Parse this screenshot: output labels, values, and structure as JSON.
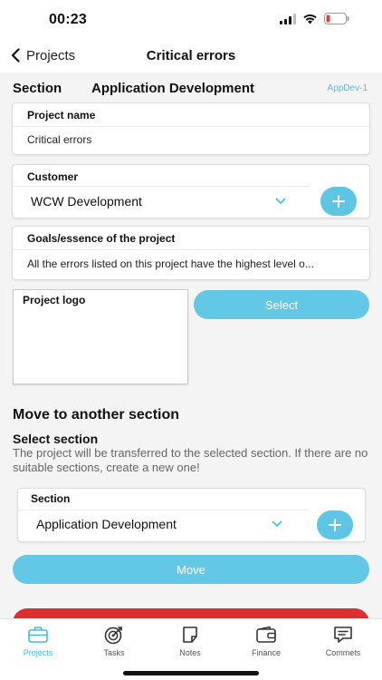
{
  "status_bar": {
    "time": "00:23"
  },
  "nav": {
    "back_label": "Projects",
    "title": "Critical errors"
  },
  "section": {
    "label": "Section",
    "value": "Application Development",
    "code": "AppDev-1"
  },
  "fields": {
    "project_name": {
      "label": "Project name",
      "value": "Critical errors"
    },
    "customer": {
      "label": "Customer",
      "value": "WCW Development"
    },
    "goals": {
      "label": "Goals/essence of the project",
      "value": "All the errors listed on this project have the highest level o..."
    },
    "logo": {
      "label": "Project logo",
      "select_label": "Select"
    }
  },
  "move": {
    "heading": "Move to another section",
    "subheading": "Select section",
    "help": "The project will be transferred to the selected section. If there are no suitable sections, create a new one!",
    "section_label": "Section",
    "section_value": "Application Development",
    "move_label": "Move"
  },
  "tabs": [
    {
      "label": "Projects",
      "icon": "briefcase-icon",
      "active": true
    },
    {
      "label": "Tasks",
      "icon": "target-icon",
      "active": false
    },
    {
      "label": "Notes",
      "icon": "note-icon",
      "active": false
    },
    {
      "label": "Finance",
      "icon": "wallet-icon",
      "active": false
    },
    {
      "label": "Commets",
      "icon": "chat-icon",
      "active": false
    }
  ],
  "colors": {
    "accent": "#5ec5e5",
    "danger": "#dc2f2f",
    "active_tab": "#49b8dc"
  }
}
